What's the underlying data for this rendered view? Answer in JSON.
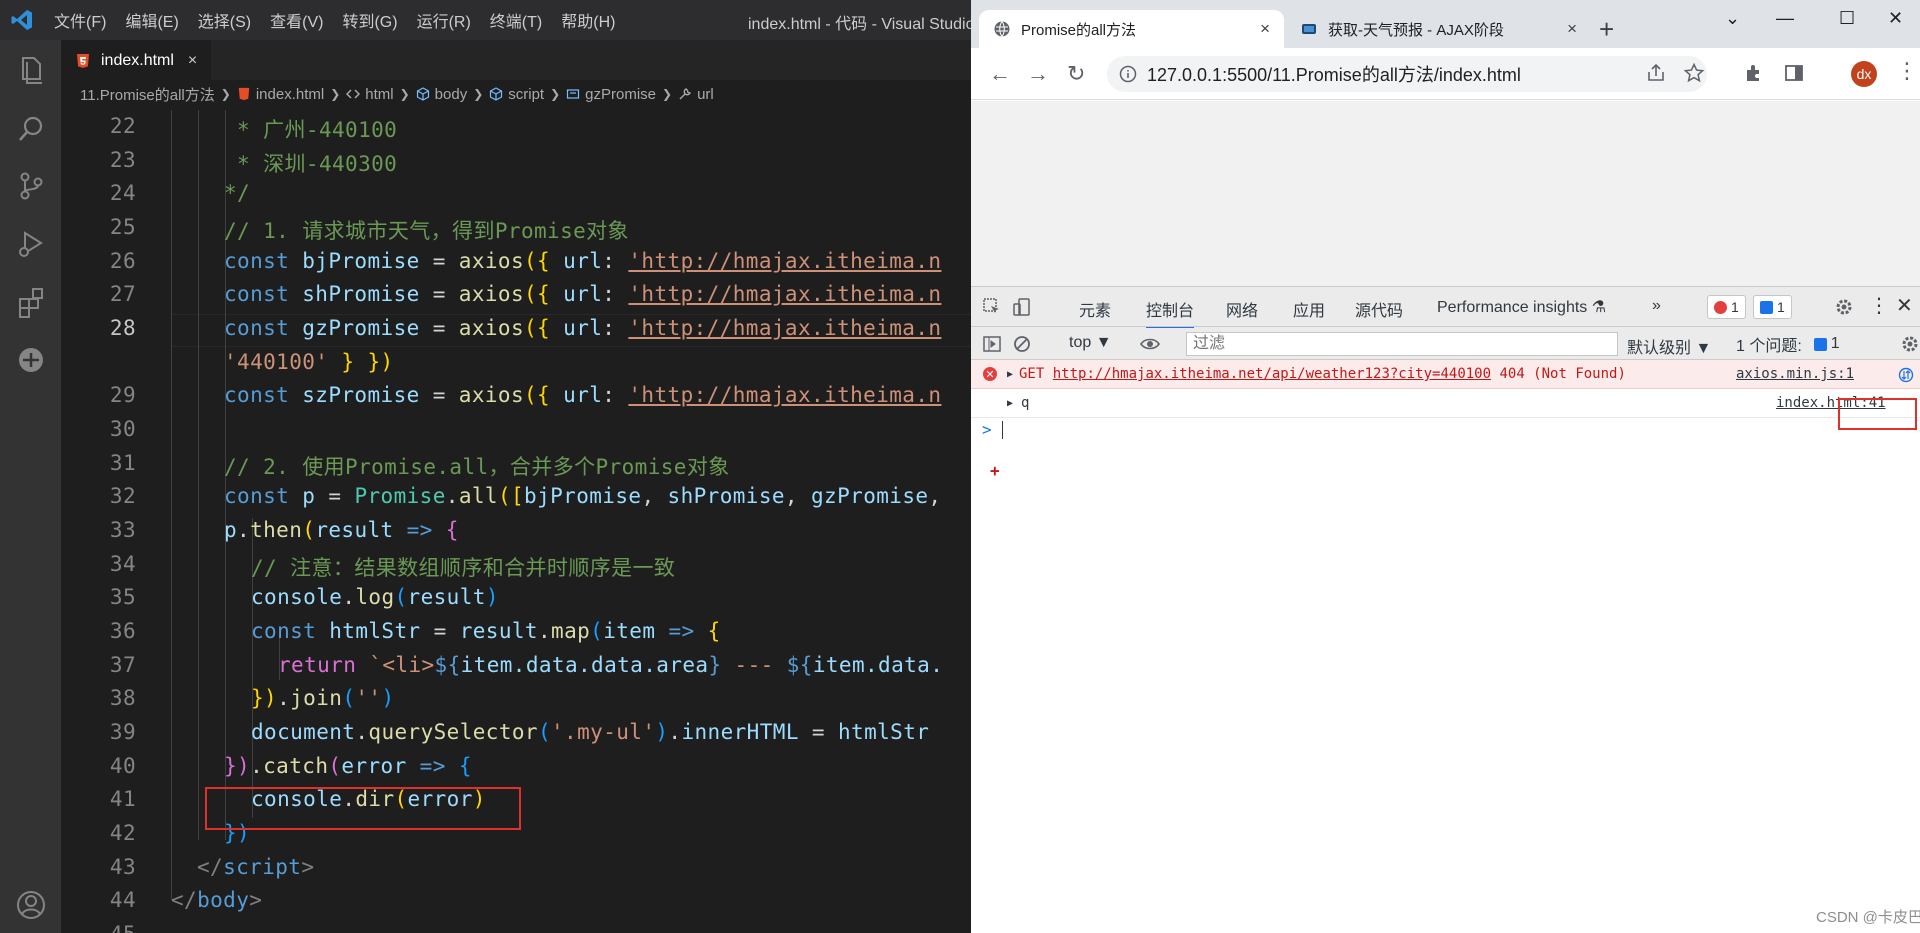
{
  "vscode": {
    "menu": [
      "文件(F)",
      "编辑(E)",
      "选择(S)",
      "查看(V)",
      "转到(G)",
      "运行(R)",
      "终端(T)",
      "帮助(H)"
    ],
    "window_title": "index.html - 代码 - Visual Studio Co",
    "tab": {
      "label": "index.html",
      "close": "×"
    },
    "breadcrumb": [
      "11.Promise的all方法",
      "index.html",
      "html",
      "body",
      "script",
      "gzPromise",
      "url"
    ],
    "line_numbers": [
      "22",
      "23",
      "24",
      "25",
      "26",
      "27",
      "28",
      "",
      "29",
      "30",
      "31",
      "32",
      "33",
      "34",
      "35",
      "36",
      "37",
      "38",
      "39",
      "40",
      "41",
      "42",
      "43",
      "44",
      "45"
    ],
    "code": {
      "l22": " * 广州-440100",
      "l23": " * 深圳-440300",
      "l24": "*/",
      "l25": "// 1. 请求城市天气，得到Promise对象",
      "l26_a": "const",
      "l26_b": " bjPromise",
      "l26_c": " = ",
      "l26_d": "axios",
      "l26_e": "({ ",
      "l26_f": "url",
      "l26_g": ": ",
      "l26_h": "'http://hmajax.itheima.n",
      "l27_b": " shPromise",
      "l28_b": " gzPromise",
      "l28w": "'440100'",
      "l28w_b": " } })",
      "l29_b": " szPromise",
      "l31": "// 2. 使用Promise.all，合并多个Promise对象",
      "l32_b": " p",
      "l32_d": "Promise",
      "l32_e": ".",
      "l32_f": "all",
      "l32_g": "([",
      "l32_h": "bjPromise",
      "l32_i": ", ",
      "l32_j": "shPromise",
      "l32_k": "gzPromise",
      "l32_l": ",",
      "l33_a": "p",
      "l33_b": ".",
      "l33_c": "then",
      "l33_d": "(",
      "l33_e": "result",
      "l33_f": " => ",
      "l33_g": "{",
      "l34": "// 注意：结果数组顺序和合并时顺序是一致",
      "l35_a": "console",
      "l35_b": ".",
      "l35_c": "log",
      "l35_d": "(",
      "l35_e": "result",
      "l35_f": ")",
      "l36_b": " htmlStr",
      "l36_d": "result",
      "l36_e": ".",
      "l36_f": "map",
      "l36_g": "(",
      "l36_h": "item",
      "l36_i": " => ",
      "l36_j": "{",
      "l37_a": "return",
      "l37_b": " `<li>",
      "l37_c": "${",
      "l37_d": "item.data.data.area",
      "l37_e": "}",
      "l37_f": " --- ",
      "l37_g": "${",
      "l37_h": "item.data.",
      "l38_a": "})",
      "l38_b": ".",
      "l38_c": "join",
      "l38_d": "(",
      "l38_e": "''",
      "l38_f": ")",
      "l39_a": "document",
      "l39_b": ".",
      "l39_c": "querySelector",
      "l39_d": "(",
      "l39_e": "'.my-ul'",
      "l39_f": ")",
      "l39_g": ".",
      "l39_h": "innerHTML",
      "l39_i": " = ",
      "l39_j": "htmlStr",
      "l40_a": "})",
      "l40_b": ".",
      "l40_c": "catch",
      "l40_d": "(",
      "l40_e": "error",
      "l40_f": " => ",
      "l40_g": "{",
      "l41_a": "console",
      "l41_b": ".",
      "l41_c": "dir",
      "l41_d": "(",
      "l41_e": "error",
      "l41_f": ")",
      "l42": "})",
      "l43_a": "</",
      "l43_b": "script",
      "l43_c": ">",
      "l44_a": "</",
      "l44_b": "body",
      "l44_c": ">"
    }
  },
  "browser": {
    "tab1": {
      "title": "Promise的all方法",
      "close": "×"
    },
    "tab2": {
      "title": "获取-天气预报 - AJAX阶段",
      "close": "×"
    },
    "new_tab": "+",
    "window_controls": [
      "⌄",
      "—",
      "☐",
      "✕"
    ],
    "url": "127.0.0.1:5500/11.Promise的all方法/index.html",
    "avatar": "dx",
    "devtools": {
      "tabs": [
        "元素",
        "控制台",
        "网络",
        "应用",
        "源代码",
        "Performance insights ⚗",
        "»"
      ],
      "error_count": "1",
      "message_count": "1",
      "context": "top ▼",
      "filter_placeholder": "过滤",
      "level": "默认级别 ▼",
      "issues_label": "1 个问题:",
      "issues_count": "1",
      "error_row": {
        "method": "GET",
        "url": "http://hmajax.itheima.net/api/weather123?city=440100",
        "status": "404 (Not Found)",
        "source": "axios.min.js:1"
      },
      "log_row": {
        "text": "q",
        "source": "index.html:41"
      },
      "prompt": ">"
    }
  },
  "watermark": "CSDN @卡皮巴拉"
}
